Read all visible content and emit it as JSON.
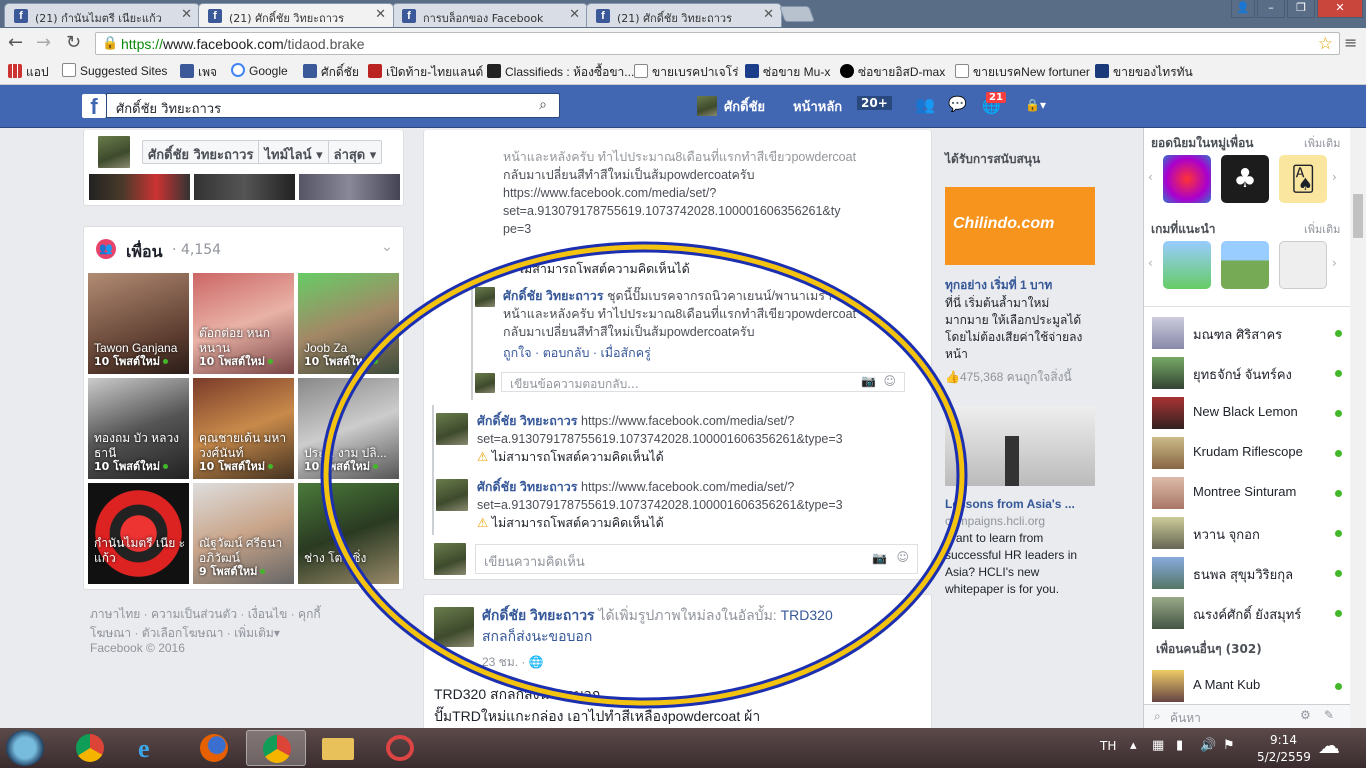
{
  "tabs": [
    {
      "label": "(21) กำนันไมตรี เนียะแก้ว",
      "active": false
    },
    {
      "label": "(21) ศักดิ์ชัย วิทยะถาวร",
      "active": true
    },
    {
      "label": "การบล็อกของ Facebook",
      "active": false
    },
    {
      "label": "(21) ศักดิ์ชัย วิทยะถาวร",
      "active": false
    }
  ],
  "url": {
    "scheme": "https://",
    "host": "www.facebook.com",
    "path": "/tidaod.brake"
  },
  "bookmarks": [
    "แอป",
    "Suggested Sites",
    "เพจ",
    "Google",
    "ศักดิ์ชัย",
    "เปิดท้าย-ไทยแลนด์",
    "Classifieds : ห้องซื้อขา...",
    "ขายเบรคปาเจโร่",
    "ซ่อขาย Mu-x",
    "ซ่อขายอิสD-max",
    "ขายเบรคNew fortuner",
    "ขายของไทรทัน"
  ],
  "header": {
    "logo": "f",
    "search_value": "ศักดิ์ชัย วิทยะถาวร",
    "user": "ศักดิ์ชัย",
    "home": "หน้าหลัก",
    "home_count": "20+",
    "notif_count": "21"
  },
  "profile_nav": {
    "name": "ศักดิ์ชัย วิทยะถาวร",
    "timeline": "ไทม์ไลน์",
    "recent": "ล่าสุด"
  },
  "friends": {
    "title": "เพื่อน",
    "count": "4,154",
    "items": [
      {
        "name": "Tawon Ganjana",
        "posts": "10 โพสต์ใหม่"
      },
      {
        "name": "ต๊อกต่อย หนก หนาน",
        "posts": "10 โพสต์ใหม่"
      },
      {
        "name": "Joob Za",
        "posts": "10 โพสต์ใหม่"
      },
      {
        "name": "ทองถม บัว หลวง ธานี",
        "posts": "10 โพสต์ใหม่"
      },
      {
        "name": "คุณชายเด้น มหาวงศ์นันท์",
        "posts": "10 โพสต์ใหม่"
      },
      {
        "name": "ประ... งาม ปลิ...",
        "posts": "10 โพสต์ใหม่"
      },
      {
        "name": "กำนันไมตรี เนีย ะแก้ว",
        "posts": ""
      },
      {
        "name": "ณัฐวัฒน์ ศรีธนา อภิวัฒน์",
        "posts": "9 โพสต์ใหม่"
      },
      {
        "name": "ช่าง โต...ซิ่ง",
        "posts": ""
      }
    ]
  },
  "footer": {
    "line1": [
      "ภาษาไทย",
      "ความเป็นส่วนตัว",
      "เงื่อนไข",
      "คุกกี้"
    ],
    "line2": [
      "โฆษณา",
      "ตัวเลือกโฆษณา",
      "เพิ่มเติม"
    ],
    "copyright": "Facebook © 2016"
  },
  "feed": {
    "comment_top_lines": [
      "หน้าและหลังครับ ทำไปประมาณ8เดือนที่แรกทำสีเขียวpowdercoat",
      "กลับมาเปลี่ยนสีทำสีใหม่เป็นส้มpowdercoatครับ",
      "https://www.facebook.com/media/set/?",
      "set=a.913079178755619.1073742028.100001606356261&ty",
      "pe=3"
    ],
    "warn": "ไม่สามารถโพสต์ความคิดเห็นได้",
    "reply_author": "ศักดิ์ชัย วิทยะถาวร",
    "reply_lines": [
      "ชุดนี้ปั๊มเบรคจากรถนิวคาเยนน์/พานาเมร่า",
      "หน้าและหลังครับ ทำไปประมาณ8เดือนที่แรกทำสีเขียวpowdercoat",
      "กลับมาเปลี่ยนสีทำสีใหม่เป็นส้มpowdercoatครับ"
    ],
    "reply_actions": {
      "like": "ถูกใจ",
      "reply": "ตอบกลับ",
      "time": "เมื่อสักครู่"
    },
    "reply_placeholder": "เขียนข้อความตอบกลับ...",
    "c2_author": "ศักดิ์ชัย วิทยะถาวร",
    "c2_link1": "https://www.facebook.com/media/set/?",
    "c2_link2": "set=a.913079178755619.1073742028.100001606356261&type=3",
    "c3_author": "ศักดิ์ชัย วิทยะถาวร",
    "c3_link1": "https://www.facebook.com/media/set/?",
    "c3_link2": "set=a.913079178755619.1073742028.100001606356261&type=3",
    "comment_placeholder": "เขียนความคิดเห็น",
    "post_author": "ศักดิ์ชัย วิทยะถาวร",
    "post_action": "ได้เพิ่มรูปภาพใหม่ลงในอัลบั้ม:",
    "post_album": "TRD320",
    "post_album2": "สกลก็ส่งนะขอบอก",
    "post_time": "23 ชม.",
    "post_text1": "TRD320 สกลก็ส่งนะขอบอก",
    "post_text2": "ปั๊มTRDใหม่แกะกล่อง เอาไปทำสีเหลืองpowdercoat ผ้า"
  },
  "ads": {
    "title": "ได้รับการสนับสนุน",
    "ad1_brand": "Chilindo.com",
    "ad1_head": "ทุกอย่าง เริ่มที่ 1 บาท",
    "ad1_body": "ที่นี่ เริ่มต้นล้ำมาใหม่ มากมาย ให้เลือกประมูลได้ โดยไม่ต้องเสียค่าใช้จ่ายลง หน้า",
    "ad1_likes": "475,368 คนถูกใจสิ่งนี้",
    "ad2_head": "Lessons from Asia's ...",
    "ad2_domain": "campaigns.hcli.org",
    "ad2_body": "Want to learn from successful HR leaders in Asia? HCLI's new whitepaper is for you."
  },
  "chat": {
    "popular_title": "ยอดนิยมในหมู่เพื่อน",
    "more": "เพิ่มเติม",
    "suggested_title": "เกมที่แนะนำ",
    "contacts": [
      "มณฑล ศิริสาคร",
      "ยุทธจักษ์ จันทร์คง",
      "New Black Lemon",
      "Krudam Riflescope",
      "Montree Sinturam",
      "หวาน จุกอก",
      "ธนพล สุขุมวิริยกุล",
      "ณรงค์ศักดิ์ ยังสมุทร์"
    ],
    "others": "เพื่อนคนอื่นๆ (302)",
    "last_contact": "A Mant Kub",
    "search_placeholder": "ค้นหา"
  },
  "taskbar": {
    "lang": "TH",
    "time": "9:14",
    "date": "5/2/2559"
  }
}
